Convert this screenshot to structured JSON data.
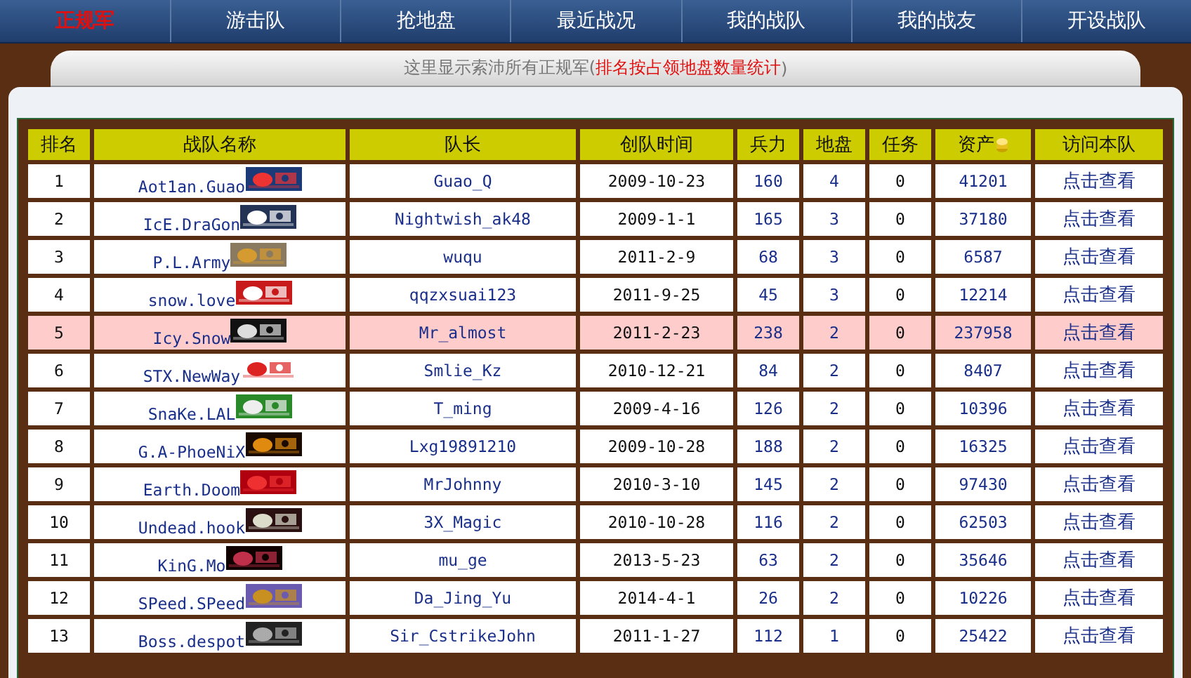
{
  "nav": [
    {
      "label": "正规军",
      "selected": true
    },
    {
      "label": "游击队",
      "selected": false
    },
    {
      "label": "抢地盘",
      "selected": false
    },
    {
      "label": "最近战况",
      "selected": false
    },
    {
      "label": "我的战队",
      "selected": false
    },
    {
      "label": "我的战友",
      "selected": false
    },
    {
      "label": "开设战队",
      "selected": false
    }
  ],
  "notice": {
    "text": "这里显示索沛所有正规军(",
    "emphasis": "排名按占领地盘数量统计",
    "close": ")"
  },
  "table": {
    "columns": [
      "排名",
      "战队名称",
      "队长",
      "创队时间",
      "兵力",
      "地盘",
      "任务",
      "资产",
      "访问本队"
    ],
    "rows": [
      {
        "rank": "1",
        "team": "Aot1an.Guao",
        "leader": "Guao_Q",
        "founded": "2009-10-23",
        "troops": "160",
        "territory": "4",
        "missions": "0",
        "assets": "41201",
        "link": "点击查看",
        "selected": false
      },
      {
        "rank": "2",
        "team": "IcE.DraGon",
        "leader": "Nightwish_ak48",
        "founded": "2009-1-1",
        "troops": "165",
        "territory": "3",
        "missions": "0",
        "assets": "37180",
        "link": "点击查看",
        "selected": false
      },
      {
        "rank": "3",
        "team": "P.L.Army",
        "leader": "wuqu",
        "founded": "2011-2-9",
        "troops": "68",
        "territory": "3",
        "missions": "0",
        "assets": "6587",
        "link": "点击查看",
        "selected": false
      },
      {
        "rank": "4",
        "team": "snow.love",
        "leader": "qqzxsuai123",
        "founded": "2011-9-25",
        "troops": "45",
        "territory": "3",
        "missions": "0",
        "assets": "12214",
        "link": "点击查看",
        "selected": false
      },
      {
        "rank": "5",
        "team": "Icy.Snow",
        "leader": "Mr_almost",
        "founded": "2011-2-23",
        "troops": "238",
        "territory": "2",
        "missions": "0",
        "assets": "237958",
        "link": "点击查看",
        "selected": true
      },
      {
        "rank": "6",
        "team": "STX.NewWay",
        "leader": "Smlie_Kz",
        "founded": "2010-12-21",
        "troops": "84",
        "territory": "2",
        "missions": "0",
        "assets": "8407",
        "link": "点击查看",
        "selected": false
      },
      {
        "rank": "7",
        "team": "SnaKe.LAL",
        "leader": "T_ming",
        "founded": "2009-4-16",
        "troops": "126",
        "territory": "2",
        "missions": "0",
        "assets": "10396",
        "link": "点击查看",
        "selected": false
      },
      {
        "rank": "8",
        "team": "G.A-PhoeNiX",
        "leader": "Lxg19891210",
        "founded": "2009-10-28",
        "troops": "188",
        "territory": "2",
        "missions": "0",
        "assets": "16325",
        "link": "点击查看",
        "selected": false
      },
      {
        "rank": "9",
        "team": "Earth.Doom",
        "leader": "MrJohnny",
        "founded": "2010-3-10",
        "troops": "145",
        "territory": "2",
        "missions": "0",
        "assets": "97430",
        "link": "点击查看",
        "selected": false
      },
      {
        "rank": "10",
        "team": "Undead.hook",
        "leader": "3X_Magic",
        "founded": "2010-10-28",
        "troops": "116",
        "territory": "2",
        "missions": "0",
        "assets": "62503",
        "link": "点击查看",
        "selected": false
      },
      {
        "rank": "11",
        "team": "KinG.Mo",
        "leader": "mu_ge",
        "founded": "2013-5-23",
        "troops": "63",
        "territory": "2",
        "missions": "0",
        "assets": "35646",
        "link": "点击查看",
        "selected": false
      },
      {
        "rank": "12",
        "team": "SPeed.SPeed",
        "leader": "Da_Jing_Yu",
        "founded": "2014-4-1",
        "troops": "26",
        "territory": "2",
        "missions": "0",
        "assets": "10226",
        "link": "点击查看",
        "selected": false
      },
      {
        "rank": "13",
        "team": "Boss.despot",
        "leader": "Sir_CstrikeJohn",
        "founded": "2011-1-27",
        "troops": "112",
        "territory": "1",
        "missions": "0",
        "assets": "25422",
        "link": "点击查看",
        "selected": false
      }
    ]
  }
}
